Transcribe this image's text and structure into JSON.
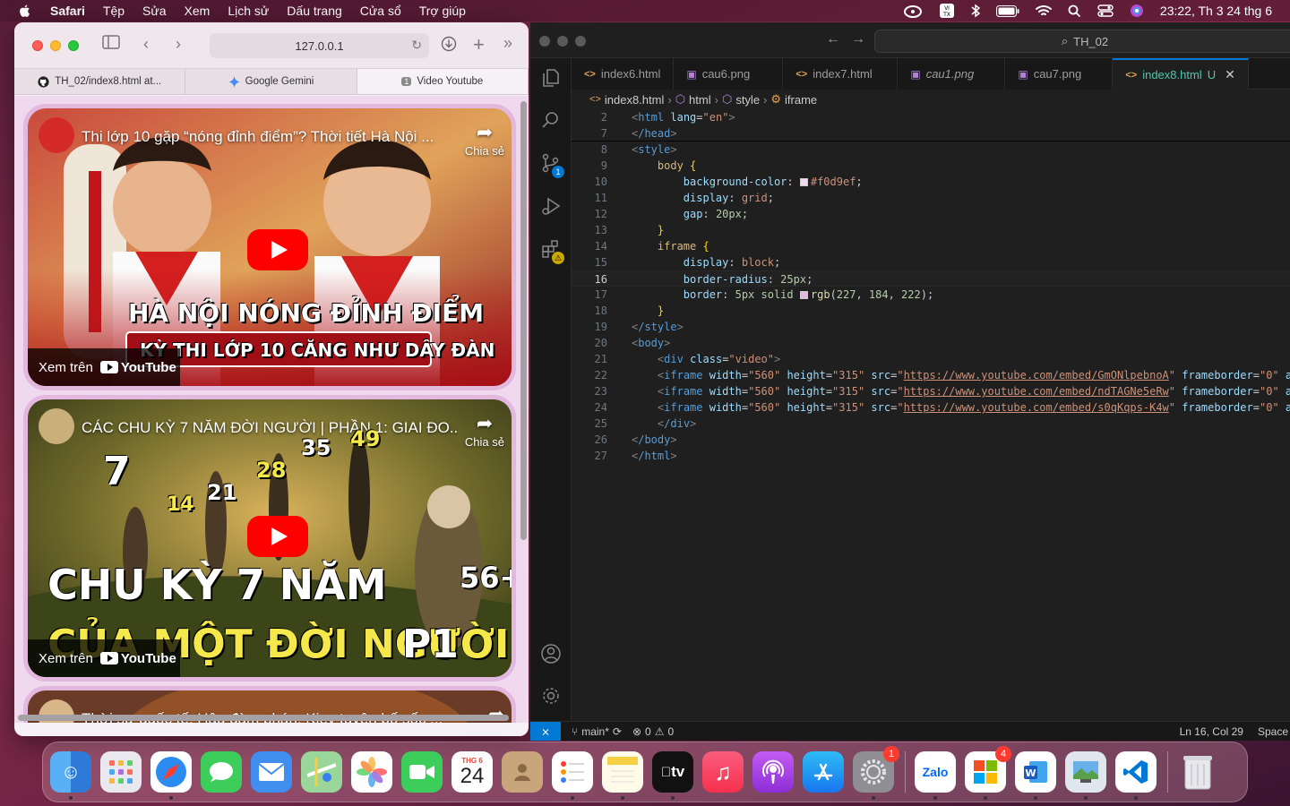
{
  "menubar": {
    "app": "Safari",
    "items": [
      "Tệp",
      "Sửa",
      "Xem",
      "Lịch sử",
      "Dấu trang",
      "Cửa sổ",
      "Trợ giúp"
    ],
    "clock": "23:22, Th 3 24 thg 6"
  },
  "safari": {
    "url": "127.0.0.1",
    "tabs": [
      {
        "label": "TH_02/index8.html at..."
      },
      {
        "label": "Google Gemini"
      },
      {
        "label": "Video Youtube",
        "badge": "1"
      }
    ],
    "videos": [
      {
        "title": "Thi lớp 10 gặp “nóng đỉnh điểm”? Thời tiết Hà Nội ...",
        "share": "Chia sẻ",
        "watch": "Xem trên",
        "youtube": "YouTube",
        "headline1": "HÀ NỘI NÓNG ĐỈNH ĐIỂM",
        "headline2": "KỲ THI LỚP 10 CĂNG NHƯ DÂY ĐÀN"
      },
      {
        "title": "CÁC CHU KỲ 7 NĂM ĐỜI NGƯỜI | PHẦN 1: GIAI ĐO...",
        "share": "Chia sẻ",
        "watch": "Xem trên",
        "youtube": "YouTube",
        "headline1": "CHU KỲ 7 NĂM",
        "headline2": "CỦA MỘT ĐỜI NGƯỜI",
        "part": "P1",
        "numbers": [
          "7",
          "14",
          "21",
          "28",
          "35",
          "49",
          "56+"
        ]
      },
      {
        "title": "Thời sự quốc tế: Hậu đàm phán, Kiev tuyên bố sốc ..."
      }
    ]
  },
  "vscode": {
    "search": "TH_02",
    "tabs": [
      {
        "label": "index6.html",
        "kind": "html"
      },
      {
        "label": "cau6.png",
        "kind": "png"
      },
      {
        "label": "index7.html",
        "kind": "html"
      },
      {
        "label": "cau1.png",
        "kind": "png"
      },
      {
        "label": "cau7.png",
        "kind": "png"
      },
      {
        "label": "index8.html",
        "kind": "html",
        "modified": "U"
      }
    ],
    "breadcrumb": [
      "index8.html",
      "html",
      "style",
      "iframe"
    ],
    "line_numbers": [
      "2",
      "7",
      "8",
      "9",
      "10",
      "11",
      "12",
      "13",
      "14",
      "15",
      "16",
      "17",
      "18",
      "19",
      "20",
      "21",
      "22",
      "23",
      "24",
      "25",
      "26",
      "27"
    ],
    "code": {
      "l2_tag": "html",
      "l2_attr": "lang",
      "l2_val": "\"en\"",
      "l7_tag": "/head",
      "l8_tag": "style",
      "l9_sel": "body",
      "l10_prop": "background-color",
      "l10_val": "#f0d9ef",
      "l11_prop": "display",
      "l11_val": "grid",
      "l12_prop": "gap",
      "l12_val": "20px",
      "l14_sel": "iframe",
      "l15_prop": "display",
      "l15_val": "block",
      "l16_prop": "border-radius",
      "l16_val": "25px",
      "l17_prop": "border",
      "l17_val": "5px solid",
      "l17_fn": "rgb",
      "l17_args": "227, 184, 222",
      "l19_tag": "/style",
      "l20_tag": "body",
      "l21_tag": "div",
      "l21_attr": "class",
      "l21_val": "\"video\"",
      "iframe_width": "\"560\"",
      "iframe_height": "\"315\"",
      "frameborder": "\"0\"",
      "src1": "https://www.youtube.com/embed/GmONlpebnoA",
      "src2": "https://www.youtube.com/embed/ndTAGNe5eRw",
      "src3": "https://www.youtube.com/embed/s0qKqps-K4w",
      "l25_tag": "/div",
      "l26_tag": "/body",
      "l27_tag": "/html"
    },
    "status": {
      "branch": "main*",
      "errors": "0",
      "warnings": "0",
      "position": "Ln 16, Col 29",
      "spaces": "Space"
    }
  },
  "dock": {
    "calendar_month": "THG 6",
    "calendar_day": "24",
    "settings_badge": "1",
    "office_badge": "4",
    "zalo_label": "Zalo",
    "tv_label": "tv"
  },
  "colors": {
    "page_bg": "#f0d9ef",
    "iframe_border": "rgb(227,184,222)",
    "vscode_accent": "#0078d4",
    "yt_red": "#ff0000"
  }
}
